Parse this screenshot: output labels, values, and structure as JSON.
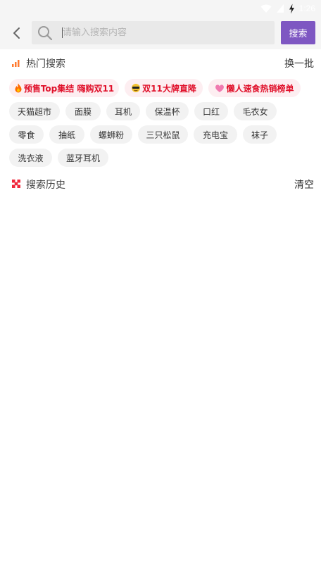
{
  "status_bar": {
    "icons": [
      "wifi-icon",
      "signal-icon",
      "battery-charging-icon"
    ],
    "time": "1:26"
  },
  "header": {
    "back_icon": "chevron-left-icon",
    "search_icon": "search-icon",
    "placeholder": "请输入搜索内容",
    "value": "",
    "search_button": "搜索"
  },
  "hot": {
    "icon": "bar-chart-icon",
    "title": "热门搜索",
    "action": "换一批",
    "promos": [
      {
        "icon": "fire-icon",
        "label": "预售Top集结 嗨购双11"
      },
      {
        "icon": "sunglasses-face-icon",
        "label": "双11大牌直降"
      },
      {
        "icon": "heart-icon",
        "label": "懒人速食热销榜单"
      }
    ],
    "tags": [
      "天猫超市",
      "面膜",
      "耳机",
      "保温杯",
      "口红",
      "毛衣女",
      "零食",
      "抽纸",
      "螺蛳粉",
      "三只松鼠",
      "充电宝",
      "袜子",
      "洗衣液",
      "蓝牙耳机"
    ]
  },
  "history": {
    "icon": "grid-icon",
    "title": "搜索历史",
    "action": "清空"
  },
  "colors": {
    "accent": "#7e57c2",
    "promo_text": "#e0102a",
    "promo_bg": "#fdeef1",
    "chip_bg": "#f2f2f2",
    "hot_icon": "#ff7a2f",
    "history_icon": "#f0283c"
  }
}
